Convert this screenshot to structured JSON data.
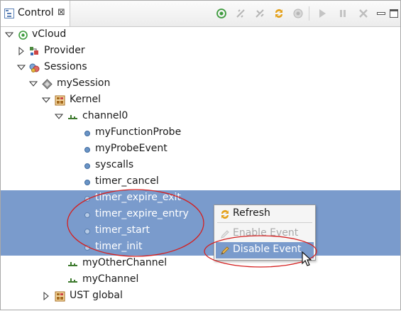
{
  "view": {
    "title": "Control",
    "close_glyph": "⊠"
  },
  "toolbar": {
    "buttons": [
      {
        "name": "connect-icon",
        "enabled": true
      },
      {
        "name": "disconnect-icon",
        "enabled": false
      },
      {
        "name": "delete-session-icon",
        "enabled": false
      },
      {
        "name": "refresh-icon",
        "enabled": true
      },
      {
        "name": "record-icon",
        "enabled": false
      },
      {
        "name": "start-icon",
        "enabled": false
      },
      {
        "name": "stop-icon",
        "enabled": false
      },
      {
        "name": "destroy-icon",
        "enabled": false
      },
      {
        "name": "minimize-icon",
        "enabled": true
      },
      {
        "name": "maximize-icon",
        "enabled": true
      }
    ]
  },
  "tree": {
    "target": "vCloud",
    "provider": "Provider",
    "sessions": "Sessions",
    "session": "mySession",
    "domain": "Kernel",
    "channel": "channel0",
    "events": [
      "myFunctionProbe",
      "myProbeEvent",
      "syscalls",
      "timer_cancel",
      "timer_expire_exit",
      "timer_expire_entry",
      "timer_start",
      "timer_init"
    ],
    "other_channel": "myOtherChannel",
    "my_channel": "myChannel",
    "ust_domain": "UST global"
  },
  "context_menu": {
    "refresh": "Refresh",
    "enable_event": "Enable Event",
    "disable_event": "Disable Event"
  },
  "colors": {
    "selection": "#7a9bcc",
    "annotation": "#d42020",
    "event_dot": "#6a94c6"
  }
}
